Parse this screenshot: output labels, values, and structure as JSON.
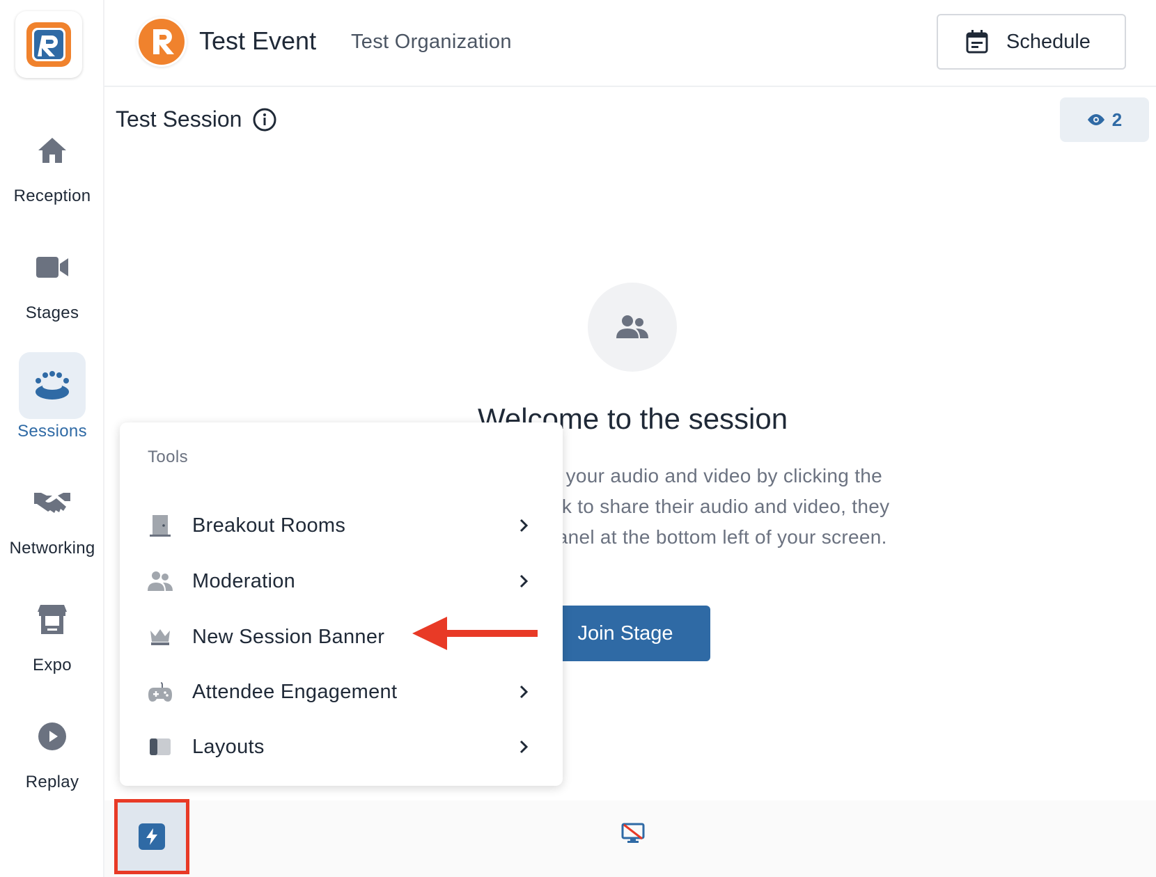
{
  "sidebar": {
    "items": [
      {
        "label": "Reception",
        "icon": "home-icon"
      },
      {
        "label": "Stages",
        "icon": "video-camera-icon"
      },
      {
        "label": "Sessions",
        "icon": "people-group-icon",
        "active": true
      },
      {
        "label": "Networking",
        "icon": "handshake-icon"
      },
      {
        "label": "Expo",
        "icon": "booth-icon"
      },
      {
        "label": "Replay",
        "icon": "play-circle-icon"
      }
    ]
  },
  "header": {
    "event_title": "Test Event",
    "organization": "Test Organization",
    "schedule_label": "Schedule"
  },
  "session": {
    "title": "Test Session",
    "viewer_count": "2"
  },
  "welcome": {
    "title": "Welcome to the session",
    "line1": "share your audio and video by clicking the",
    "line2": "ees ask to share their audio and video, they",
    "line3": "tion Panel at the bottom left of your screen.",
    "join_label": "Join Stage"
  },
  "tools_menu": {
    "header": "Tools",
    "items": [
      {
        "label": "Breakout Rooms",
        "icon": "door-icon",
        "has_submenu": true
      },
      {
        "label": "Moderation",
        "icon": "users-icon",
        "has_submenu": true
      },
      {
        "label": "New Session Banner",
        "icon": "crown-icon",
        "has_submenu": false
      },
      {
        "label": "Attendee Engagement",
        "icon": "gamepad-icon",
        "has_submenu": true
      },
      {
        "label": "Layouts",
        "icon": "layout-icon",
        "has_submenu": true
      }
    ]
  },
  "colors": {
    "accent": "#2f6aa5",
    "brand_orange": "#f0822d",
    "annotation_red": "#e83a26"
  }
}
